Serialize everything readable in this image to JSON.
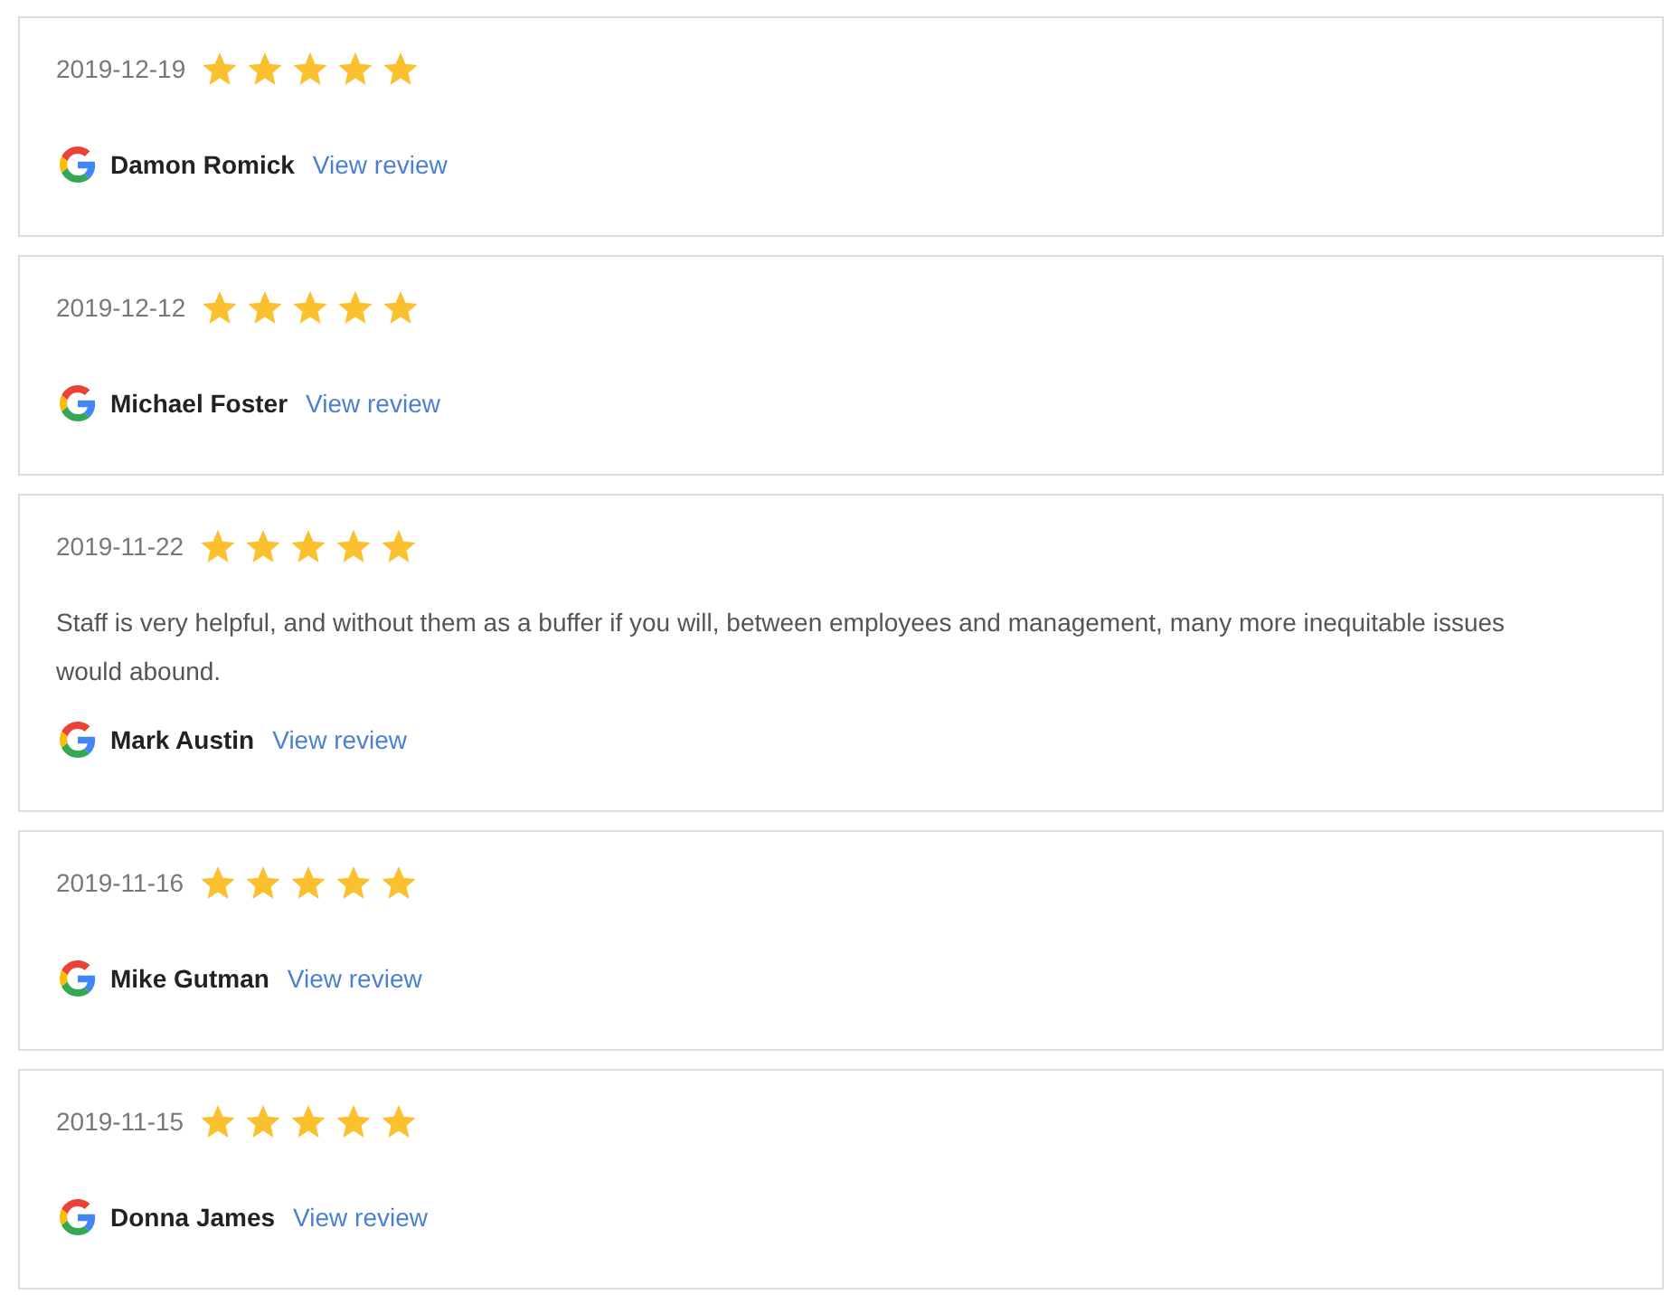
{
  "reviews": [
    {
      "date": "2019-12-19",
      "stars": 5,
      "author": "Damon Romick",
      "link": "View review"
    },
    {
      "date": "2019-12-12",
      "stars": 5,
      "author": "Michael Foster",
      "link": "View review"
    },
    {
      "date": "2019-11-22",
      "stars": 5,
      "text": "Staff is very helpful, and without them as a buffer if you will, between employees and management, many more inequitable issues would abound.",
      "author": "Mark Austin",
      "link": "View review"
    },
    {
      "date": "2019-11-16",
      "stars": 5,
      "author": "Mike Gutman",
      "link": "View review"
    },
    {
      "date": "2019-11-15",
      "stars": 5,
      "author": "Donna James",
      "link": "View review"
    }
  ]
}
